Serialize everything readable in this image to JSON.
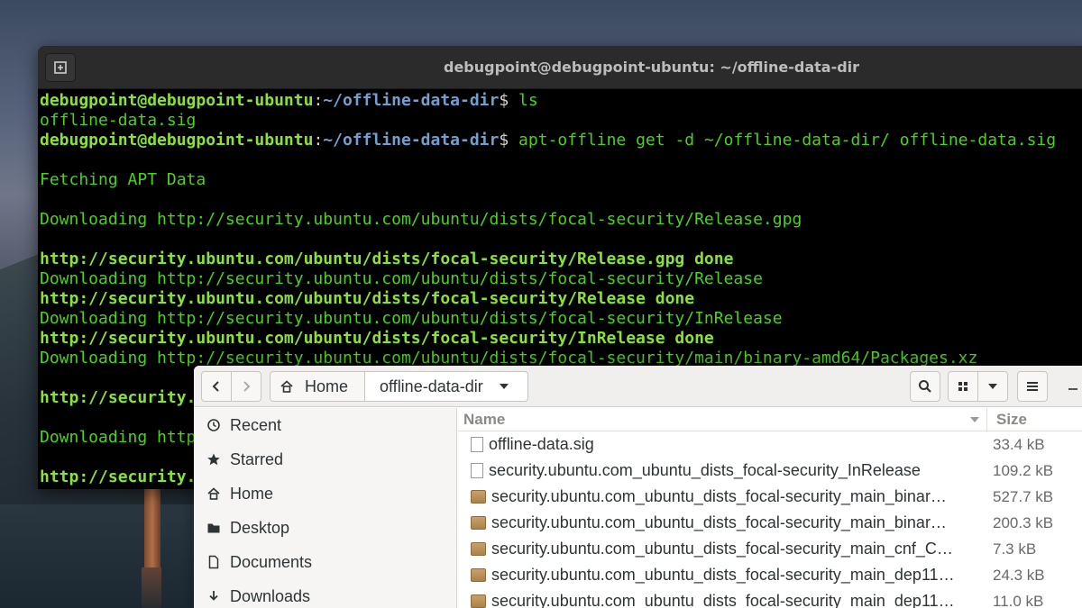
{
  "terminal": {
    "title": "debugpoint@debugpoint-ubuntu: ~/offline-data-dir",
    "prompt_user": "debugpoint@debugpoint-ubuntu",
    "prompt_path": "~/offline-data-dir",
    "lines": [
      {
        "kind": "cmd",
        "cmd": "ls"
      },
      {
        "kind": "plain",
        "text": "offline-data.sig"
      },
      {
        "kind": "cmd",
        "cmd": "apt-offline get -d ~/offline-data-dir/ offline-data.sig"
      },
      {
        "kind": "blank",
        "text": ""
      },
      {
        "kind": "plain",
        "text": "Fetching APT Data"
      },
      {
        "kind": "blank",
        "text": ""
      },
      {
        "kind": "plain",
        "text": "Downloading http://security.ubuntu.com/ubuntu/dists/focal-security/Release.gpg"
      },
      {
        "kind": "blank",
        "text": ""
      },
      {
        "kind": "bold",
        "text": "http://security.ubuntu.com/ubuntu/dists/focal-security/Release.gpg done"
      },
      {
        "kind": "plain",
        "text": "Downloading http://security.ubuntu.com/ubuntu/dists/focal-security/Release"
      },
      {
        "kind": "bold",
        "text": "http://security.ubuntu.com/ubuntu/dists/focal-security/Release done"
      },
      {
        "kind": "plain",
        "text": "Downloading http://security.ubuntu.com/ubuntu/dists/focal-security/InRelease"
      },
      {
        "kind": "bold",
        "text": "http://security.ubuntu.com/ubuntu/dists/focal-security/InRelease done"
      },
      {
        "kind": "plain",
        "text": "Downloading http://security.ubuntu.com/ubuntu/dists/focal-security/main/binary-amd64/Packages.xz"
      },
      {
        "kind": "blank",
        "text": ""
      },
      {
        "kind": "bold",
        "text": "http://security."
      },
      {
        "kind": "blank",
        "text": ""
      },
      {
        "kind": "plain",
        "text": "Downloading http"
      },
      {
        "kind": "blank",
        "text": ""
      },
      {
        "kind": "bold",
        "text": "http://security."
      }
    ]
  },
  "files": {
    "breadcrumb_home": "Home",
    "breadcrumb_dir": "offline-data-dir",
    "sidebar": [
      {
        "label": "Recent",
        "icon": "clock-icon"
      },
      {
        "label": "Starred",
        "icon": "star-icon"
      },
      {
        "label": "Home",
        "icon": "home-icon"
      },
      {
        "label": "Desktop",
        "icon": "folder-icon"
      },
      {
        "label": "Documents",
        "icon": "document-icon"
      },
      {
        "label": "Downloads",
        "icon": "download-icon"
      }
    ],
    "columns": {
      "name": "Name",
      "size": "Size"
    },
    "rows": [
      {
        "name": "offline-data.sig",
        "size": "33.4 kB",
        "type": "file"
      },
      {
        "name": "security.ubuntu.com_ubuntu_dists_focal-security_InRelease",
        "size": "109.2 kB",
        "type": "file"
      },
      {
        "name": "security.ubuntu.com_ubuntu_dists_focal-security_main_binar…",
        "size": "527.7 kB",
        "type": "package"
      },
      {
        "name": "security.ubuntu.com_ubuntu_dists_focal-security_main_binar…",
        "size": "200.3 kB",
        "type": "package"
      },
      {
        "name": "security.ubuntu.com_ubuntu_dists_focal-security_main_cnf_C…",
        "size": "7.3 kB",
        "type": "package"
      },
      {
        "name": "security.ubuntu.com_ubuntu_dists_focal-security_main_dep11…",
        "size": "24.3 kB",
        "type": "package"
      },
      {
        "name": "security.ubuntu.com_ubuntu_dists_focal-security_main_dep11…",
        "size": "11.0 kB",
        "type": "package"
      }
    ]
  }
}
